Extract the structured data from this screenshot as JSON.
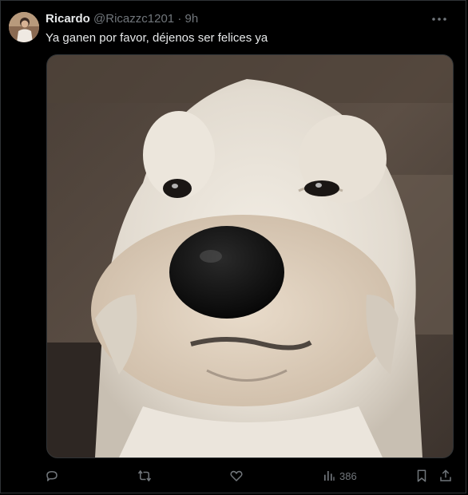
{
  "tweet": {
    "author_name": "Ricardo",
    "handle": "@Ricazzc1201",
    "separator": "·",
    "time": "9h",
    "text": "Ya ganen por favor, déjenos ser felices ya"
  },
  "actions": {
    "reply_icon": "reply-bubble-icon",
    "retweet_icon": "retweet-icon",
    "like_icon": "heart-icon",
    "views_icon": "views-bar-chart-icon",
    "views_count": "386",
    "bookmark_icon": "bookmark-icon",
    "share_icon": "share-upload-icon"
  },
  "colors": {
    "background": "#000000",
    "text_primary": "#e7e9ea",
    "text_secondary": "#71767b",
    "border": "#2f3336"
  }
}
